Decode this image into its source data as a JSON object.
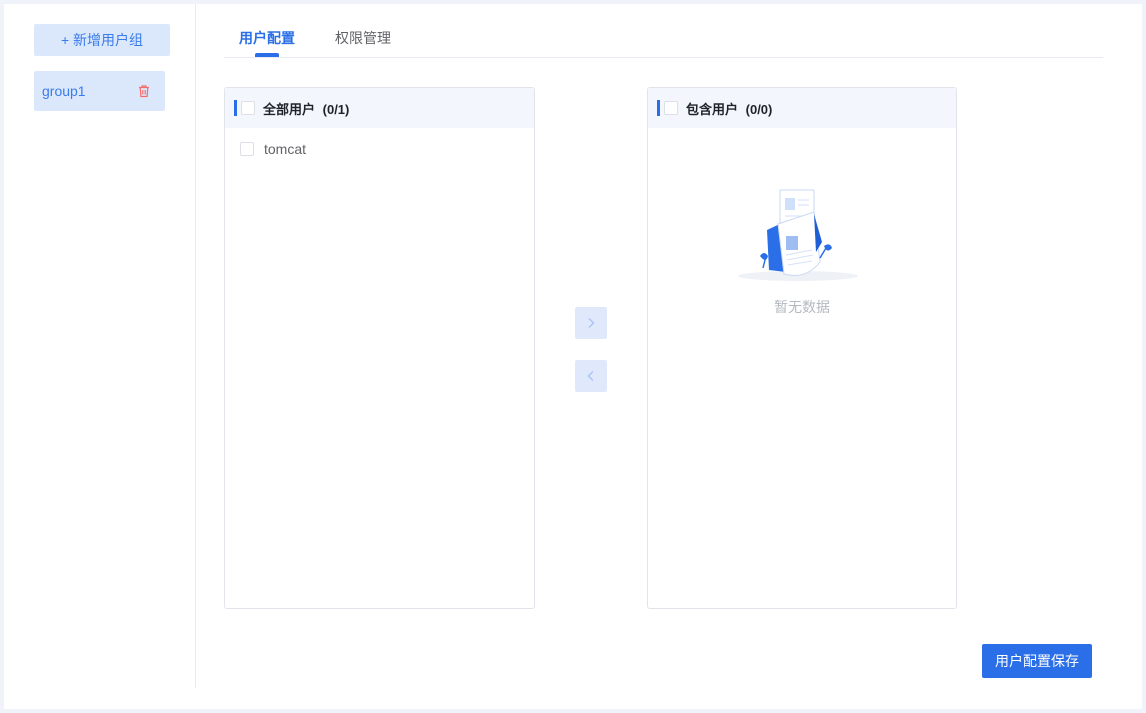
{
  "sidebar": {
    "add_group_label": "+ 新增用户组",
    "groups": [
      {
        "label": "group1"
      }
    ]
  },
  "tabs": [
    {
      "label": "用户配置",
      "active": true
    },
    {
      "label": "权限管理",
      "active": false
    }
  ],
  "transfer": {
    "left": {
      "title": "全部用户",
      "count": "(0/1)",
      "items": [
        {
          "label": "tomcat",
          "checked": false
        }
      ]
    },
    "right": {
      "title": "包含用户",
      "count": "(0/0)",
      "items": [],
      "empty_text": "暂无数据"
    },
    "move_right_icon": "chevron-right-icon",
    "move_left_icon": "chevron-left-icon"
  },
  "save_button_label": "用户配置保存",
  "colors": {
    "primary": "#2a6fe8",
    "primary_light": "#dbe8fb",
    "danger": "#f56c6c"
  }
}
